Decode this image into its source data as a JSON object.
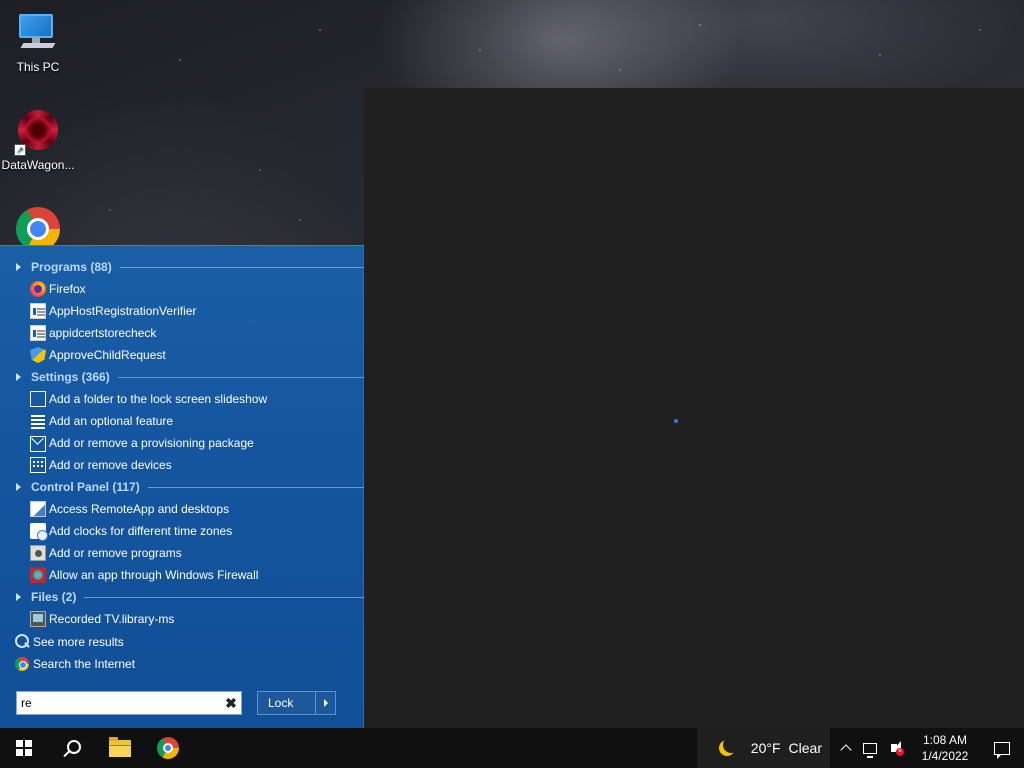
{
  "desktop": {
    "icons": [
      {
        "label": "This PC",
        "icon": "this-pc-icon"
      },
      {
        "label": "DataWagon...",
        "icon": "datawagon-icon"
      },
      {
        "label": "",
        "icon": "chrome-icon"
      }
    ]
  },
  "start_menu": {
    "categories": [
      {
        "label": "Programs (88)",
        "items": [
          {
            "label": "Firefox",
            "icon": "firefox-icon"
          },
          {
            "label": "AppHostRegistrationVerifier",
            "icon": "app-icon"
          },
          {
            "label": "appidcertstorecheck",
            "icon": "app-icon"
          },
          {
            "label": "ApproveChildRequest",
            "icon": "shield-icon"
          }
        ]
      },
      {
        "label": "Settings (366)",
        "items": [
          {
            "label": "Add a folder to the lock screen slideshow",
            "icon": "lock-screen-icon"
          },
          {
            "label": "Add an optional feature",
            "icon": "list-icon"
          },
          {
            "label": "Add or remove a provisioning package",
            "icon": "package-icon"
          },
          {
            "label": "Add or remove devices",
            "icon": "keyboard-icon"
          }
        ]
      },
      {
        "label": "Control Panel (117)",
        "items": [
          {
            "label": "Access RemoteApp and desktops",
            "icon": "remote-app-icon"
          },
          {
            "label": "Add clocks for different time zones",
            "icon": "clock-icon"
          },
          {
            "label": "Add or remove programs",
            "icon": "programs-icon"
          },
          {
            "label": "Allow an app through Windows Firewall",
            "icon": "firewall-icon"
          }
        ]
      },
      {
        "label": "Files (2)",
        "items": [
          {
            "label": "Recorded TV.library-ms",
            "icon": "tv-library-icon"
          }
        ]
      }
    ],
    "see_more": "See more results",
    "search_internet": "Search the Internet",
    "search_value": "re",
    "clear_glyph": "✖",
    "lock_label": "Lock"
  },
  "taskbar": {
    "weather_temp": "20°F",
    "weather_desc": "Clear",
    "time": "1:08 AM",
    "date": "1/4/2022"
  },
  "colors": {
    "start_menu_bg": "#1556a0",
    "category_text": "#bcd8ff",
    "taskbar_bg": "#101010",
    "window_bg": "#202020"
  }
}
